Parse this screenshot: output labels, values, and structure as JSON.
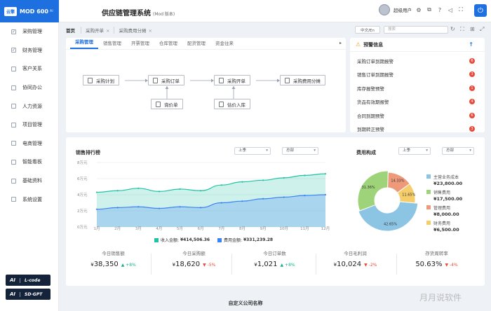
{
  "header": {
    "logo_badge": "云擎",
    "logo_name": "MOD 600",
    "logo_version": "Ai",
    "title": "供应链管理系统",
    "title_note": "(Mod 版本)",
    "user_name": "超级用户"
  },
  "breadcrumb": {
    "home": "首页",
    "tabs": [
      "采购开单",
      "采购费用分摊"
    ],
    "lang": "中文/En",
    "search_placeholder": "搜索"
  },
  "sidebar": {
    "items": [
      {
        "label": "采购管理",
        "checked": true
      },
      {
        "label": "财务管理",
        "checked": true
      },
      {
        "label": "客户关系",
        "checked": false
      },
      {
        "label": "协同办公",
        "checked": false
      },
      {
        "label": "人力资源",
        "checked": false
      },
      {
        "label": "项目管理",
        "checked": false
      },
      {
        "label": "电商管理",
        "checked": false
      },
      {
        "label": "智能看板",
        "checked": false
      },
      {
        "label": "基础资料",
        "checked": false
      },
      {
        "label": "系统设置",
        "checked": false
      }
    ],
    "ai_buttons": [
      {
        "badge": "AI",
        "label": "L-code"
      },
      {
        "badge": "AI",
        "label": "SD-GPT"
      }
    ]
  },
  "workflow": {
    "tabs": [
      "采购管理",
      "销售管理",
      "开票管理",
      "仓库管理",
      "配货管理",
      "资金往来"
    ],
    "nodes": [
      "采购计划",
      "采购订单",
      "采购开单",
      "采购费用分摊",
      "询价单",
      "估价入库"
    ]
  },
  "alerts": {
    "title": "预警信息",
    "items": [
      {
        "label": "采购订单到期报警",
        "count": "6"
      },
      {
        "label": "销售订单到期报警",
        "count": "3"
      },
      {
        "label": "库存报警预警",
        "count": "1"
      },
      {
        "label": "货品有效期报警",
        "count": "4"
      },
      {
        "label": "合同到期预警",
        "count": "6"
      },
      {
        "label": "到期转正预警",
        "count": "3"
      }
    ]
  },
  "sales": {
    "title": "销售排行榜",
    "filter_period": "上季",
    "filter_scope": "总部",
    "income_label": "收入金额:",
    "income_total": "¥414,506.36",
    "cost_label": "费用金额:",
    "cost_total": "¥331,239.28",
    "colors": {
      "income": "#1fc3a4",
      "cost": "#3b82f6"
    }
  },
  "chart_data": {
    "type": "area",
    "x": [
      "1月",
      "2月",
      "3月",
      "4月",
      "5月",
      "6月",
      "7月",
      "8月",
      "9月",
      "10月",
      "11月",
      "12月"
    ],
    "yticks": [
      "0万元",
      "2万元",
      "4万元",
      "6万元",
      "8万元"
    ],
    "ylim": [
      0,
      8
    ],
    "series": [
      {
        "name": "收入金额",
        "values": [
          4.3,
          4.5,
          4.8,
          4.4,
          4.7,
          4.5,
          5.2,
          5.6,
          5.8,
          6.1,
          6.4,
          6.6
        ]
      },
      {
        "name": "费用金额",
        "values": [
          2.2,
          2.4,
          2.5,
          2.3,
          2.5,
          2.4,
          3.0,
          3.2,
          3.5,
          3.7,
          3.9,
          4.0
        ]
      }
    ]
  },
  "expense": {
    "title": "费用构成",
    "filter_period": "上季",
    "filter_scope": "总部",
    "legend": [
      {
        "name": "主营业务成本",
        "value": "¥23,800.00",
        "color": "#8cc4e3"
      },
      {
        "name": "销售费用",
        "value": "¥17,500.00",
        "color": "#9fd37a"
      },
      {
        "name": "管理费用",
        "value": "¥8,000.00",
        "color": "#ee9a7a"
      },
      {
        "name": "财务费用",
        "value": "¥6,500.00",
        "color": "#f6cd6b"
      }
    ],
    "pie": [
      {
        "label": "42.65%",
        "value": 42.65
      },
      {
        "label": "31.36%",
        "value": 31.36
      },
      {
        "label": "14.33%",
        "value": 14.33
      },
      {
        "label": "11.65%",
        "value": 11.65
      }
    ]
  },
  "kpis": [
    {
      "title": "今日销售额",
      "value": "38,350",
      "delta": "+8%",
      "dir": "up"
    },
    {
      "title": "今日采购额",
      "value": "18,620",
      "delta": "-5%",
      "dir": "down"
    },
    {
      "title": "今日订单数",
      "value": "1,021",
      "delta": "+8%",
      "dir": "up"
    },
    {
      "title": "今日毛利润",
      "value": "10,024",
      "delta": "-2%",
      "dir": "down"
    },
    {
      "title": "存货周转率",
      "value": "50.63%",
      "delta": "-4%",
      "dir": "down"
    }
  ],
  "footer": "自定义公司名称",
  "watermark": "月月说软件"
}
